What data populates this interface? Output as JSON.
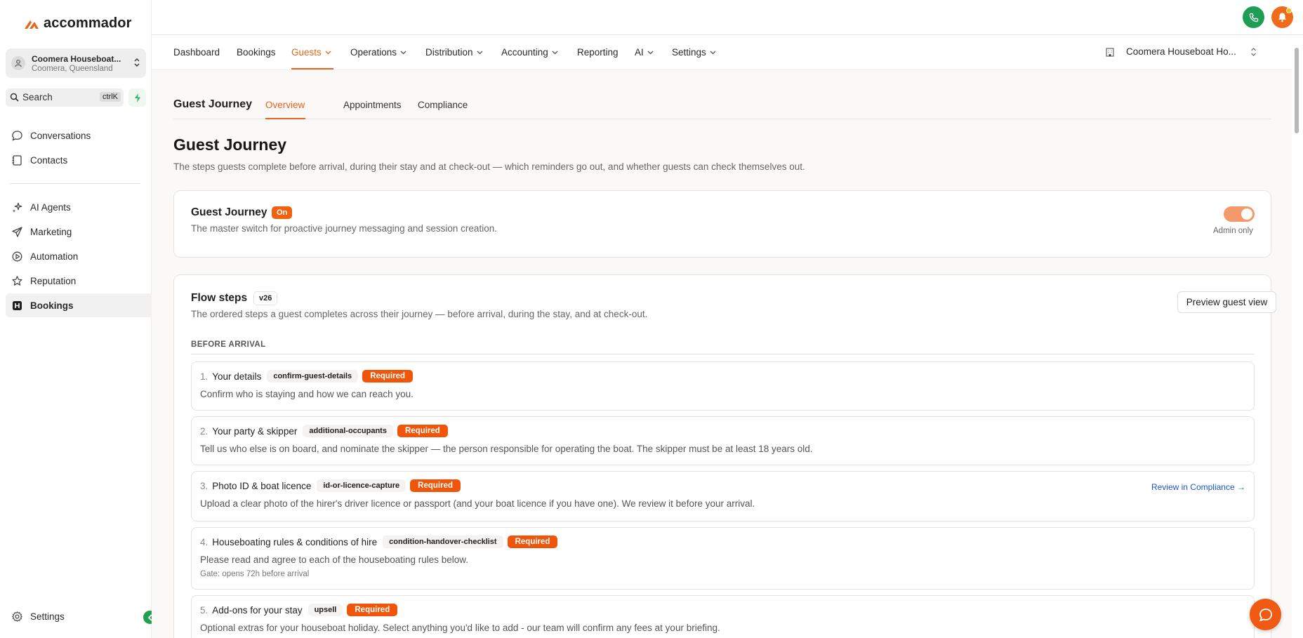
{
  "app": {
    "logo_text": "accommador",
    "org": {
      "name": "Coomera Houseboat...",
      "location": "Coomera, Queensland"
    },
    "search": {
      "label": "Search",
      "shortcut": "ctrlK"
    },
    "sidebar_items": [
      {
        "label": "Conversations",
        "icon": "chat-bubble-icon"
      },
      {
        "label": "Contacts",
        "icon": "address-book-icon"
      },
      {
        "label": "AI Agents",
        "icon": "sparkle-icon"
      },
      {
        "label": "Marketing",
        "icon": "paper-plane-icon"
      },
      {
        "label": "Automation",
        "icon": "automation-icon"
      },
      {
        "label": "Reputation",
        "icon": "star-icon"
      },
      {
        "label": "Bookings",
        "icon": "h-square-icon"
      }
    ],
    "settings_label": "Settings",
    "colors": {
      "accent": "#e8641b",
      "green": "#1f9d55",
      "required": "#f0550a"
    }
  },
  "mainnav": {
    "items": [
      "Dashboard",
      "Bookings",
      "Guests",
      "Operations",
      "Distribution",
      "Accounting",
      "Reporting",
      "AI",
      "Settings"
    ],
    "active": "Guests",
    "property": "Coomera Houseboat Ho..."
  },
  "subtabs": {
    "title": "Guest Journey",
    "tabs": [
      "Overview",
      "Appointments",
      "Compliance"
    ],
    "active": "Overview"
  },
  "page": {
    "title": "Guest Journey",
    "description": "The steps guests complete before arrival, during their stay and at check-out — which reminders go out, and whether guests can check themselves out."
  },
  "journey_card": {
    "title": "Guest Journey",
    "status": "On",
    "description": "The master switch for proactive journey messaging and session creation.",
    "toggle_note": "Admin only"
  },
  "flow": {
    "title": "Flow steps",
    "version": "v26",
    "description": "The ordered steps a guest completes across their journey — before arrival, during the stay, and at check-out.",
    "preview_label": "Preview guest view",
    "section": "BEFORE ARRIVAL",
    "steps": [
      {
        "num": "1.",
        "name": "Your details",
        "key": "confirm-guest-details",
        "badge": "Required",
        "desc": "Confirm who is staying and how we can reach you."
      },
      {
        "num": "2.",
        "name": "Your party & skipper",
        "key": "additional-occupants",
        "badge": "Required",
        "desc": "Tell us who else is on board, and nominate the skipper — the person responsible for operating the boat. The skipper must be at least 18 years old."
      },
      {
        "num": "3.",
        "name": "Photo ID & boat licence",
        "key": "id-or-licence-capture",
        "badge": "Required",
        "desc": "Upload a clear photo of the hirer's driver licence or passport (and your boat licence if you have one). We review it before your arrival.",
        "link": "Review in Compliance →"
      },
      {
        "num": "4.",
        "name": "Houseboating rules & conditions of hire",
        "key": "condition-handover-checklist",
        "badge": "Required",
        "desc": "Please read and agree to each of the houseboating rules below.",
        "gate": "Gate: opens 72h before arrival"
      },
      {
        "num": "5.",
        "name": "Add-ons for your stay",
        "key": "upsell",
        "badge": "Required",
        "desc": "Optional extras for your houseboat holiday. Select anything you'd like to add - our team will confirm any fees at your briefing."
      }
    ]
  }
}
